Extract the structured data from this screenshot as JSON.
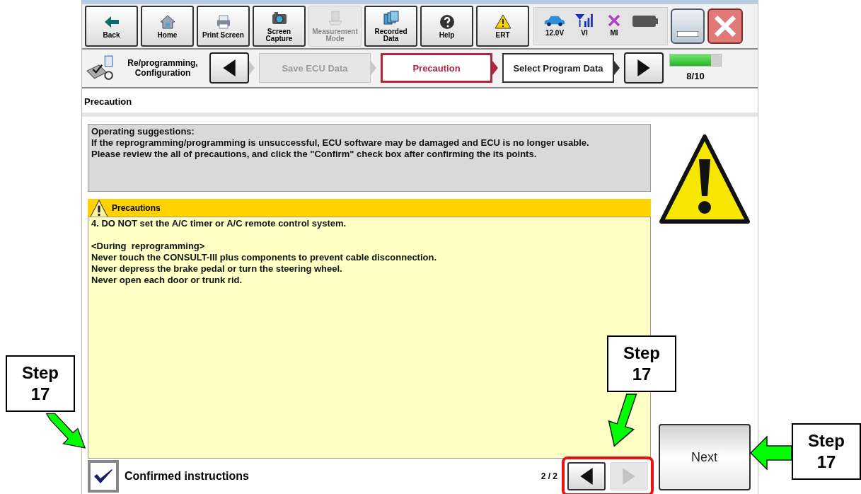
{
  "toolbar": [
    {
      "label": "Back",
      "disabled": false
    },
    {
      "label": "Home",
      "disabled": false
    },
    {
      "label": "Print Screen",
      "disabled": false
    },
    {
      "label": "Screen Capture",
      "disabled": false
    },
    {
      "label": "Measurement Mode",
      "disabled": true
    },
    {
      "label": "Recorded Data",
      "disabled": false
    },
    {
      "label": "Help",
      "disabled": false
    },
    {
      "label": "ERT",
      "disabled": false
    }
  ],
  "status": [
    {
      "label": "12.0V"
    },
    {
      "label": "VI"
    },
    {
      "label": "MI"
    }
  ],
  "breadcrumb": {
    "label": "Re/programming, Configuration",
    "steps": [
      {
        "label": "Save ECU Data",
        "selected": false,
        "disabled": true
      },
      {
        "label": "Precaution",
        "selected": true,
        "disabled": false
      },
      {
        "label": "Select Program Data",
        "selected": false,
        "disabled": false
      }
    ],
    "progress": {
      "level": 0.8,
      "label": "8/10"
    }
  },
  "page_title": "Precaution",
  "suggestions": [
    "Operating  suggestions:",
    "If the reprogramming/programming is unsuccessful, ECU software may be damaged and ECU is no longer usable.",
    "Please review the all of precautions, and click the \"Confirm\" check box after confirming the its points."
  ],
  "precautions": {
    "title": "Precautions",
    "paragraphs": [
      [
        "4. DO NOT set the A/C timer or A/C remote control system."
      ],
      [
        "<During  reprogramming>",
        "Never touch the CONSULT-III plus components to prevent cable disconnection.",
        "Never depress the brake pedal or turn the steering wheel.",
        "Never open each door or trunk rid."
      ]
    ]
  },
  "confirm": {
    "label": "Confirmed instructions",
    "checked": true
  },
  "pager": {
    "label": "2 / 2",
    "buttons": [
      {
        "disabled": false
      },
      {
        "disabled": true
      }
    ]
  },
  "next_button": "Next",
  "callouts": [
    "Step 17",
    "Step 17",
    "Step 17"
  ]
}
